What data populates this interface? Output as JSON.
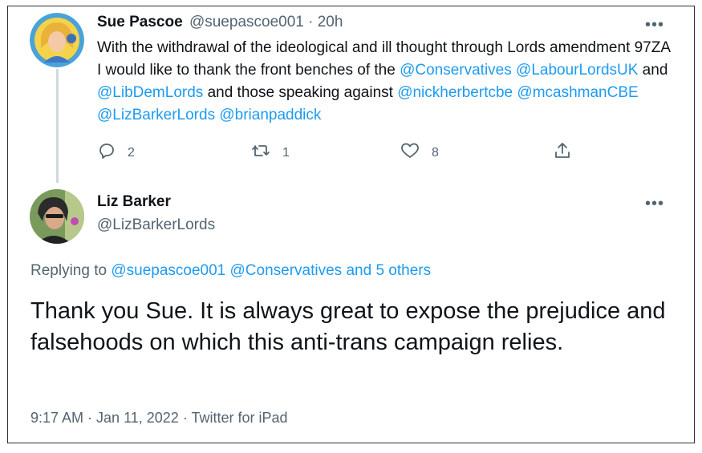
{
  "tweet1": {
    "author_name": "Sue Pascoe",
    "author_handle": "@suepascoe001",
    "separator": " · ",
    "time": "20h",
    "more_label": "•••",
    "text_segments": [
      {
        "text": "With the withdrawal of the ideological and ill thought through Lords amendment 97ZA I would like to thank the front benches of the ",
        "link": false
      },
      {
        "text": "@Conservatives",
        "link": true
      },
      {
        "text": " ",
        "link": false
      },
      {
        "text": "@LabourLordsUK",
        "link": true
      },
      {
        "text": " and ",
        "link": false
      },
      {
        "text": "@LibDemLords",
        "link": true
      },
      {
        "text": " and those speaking against ",
        "link": false
      },
      {
        "text": "@nickherbertcbe",
        "link": true
      },
      {
        "text": " ",
        "link": false
      },
      {
        "text": "@mcashmanCBE",
        "link": true
      },
      {
        "text": " ",
        "link": false
      },
      {
        "text": "@LizBarkerLords",
        "link": true
      },
      {
        "text": " ",
        "link": false
      },
      {
        "text": "@brianpaddick",
        "link": true
      }
    ],
    "actions": {
      "reply_icon": "reply-icon",
      "reply_count": "2",
      "retweet_icon": "retweet-icon",
      "retweet_count": "1",
      "like_icon": "heart-icon",
      "like_count": "8",
      "share_icon": "share-icon"
    }
  },
  "tweet2": {
    "author_name": "Liz Barker",
    "author_handle": "@LizBarkerLords",
    "more_label": "•••",
    "replying_prefix": "Replying to ",
    "replying_to": "@suepascoe001 @Conservatives and 5 others",
    "text": "Thank you Sue. It is always great to expose the prejudice and falsehoods on which this anti-trans campaign relies.",
    "time": "9:17 AM",
    "date": "Jan 11, 2022",
    "source": "Twitter for iPad",
    "meta_separator": " · "
  },
  "colors": {
    "link": "#1d9bf0",
    "muted": "#536471",
    "text": "#0f1419",
    "thread_line": "#cfd9de"
  }
}
